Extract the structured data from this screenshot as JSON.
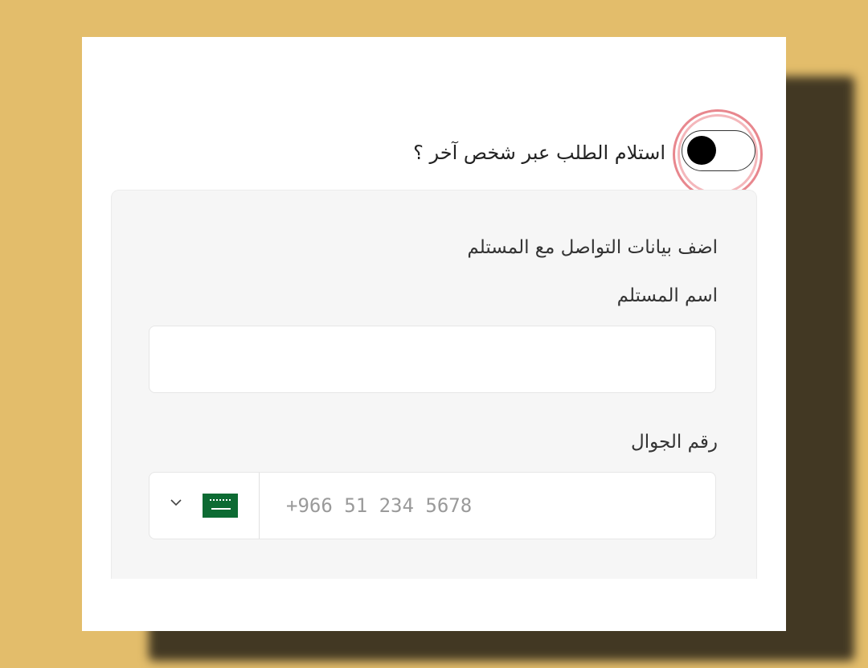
{
  "toggle": {
    "label": "استلام الطلب عبر شخص آخر ؟",
    "state": "off",
    "highlighted": true
  },
  "recipient_section": {
    "title": "اضف بيانات التواصل مع المستلم",
    "name_label": "اسم المستلم",
    "name_value": "",
    "phone_label": "رقم الجوال",
    "phone_placeholder": "+966 51 234 5678",
    "country_flag": "saudi-arabia-flag-icon",
    "country_dropdown_icon": "chevron-down-icon"
  },
  "colors": {
    "background": "#e3bd6b",
    "highlight_ring": "#e8878e",
    "flag_green": "#0d6b33"
  }
}
